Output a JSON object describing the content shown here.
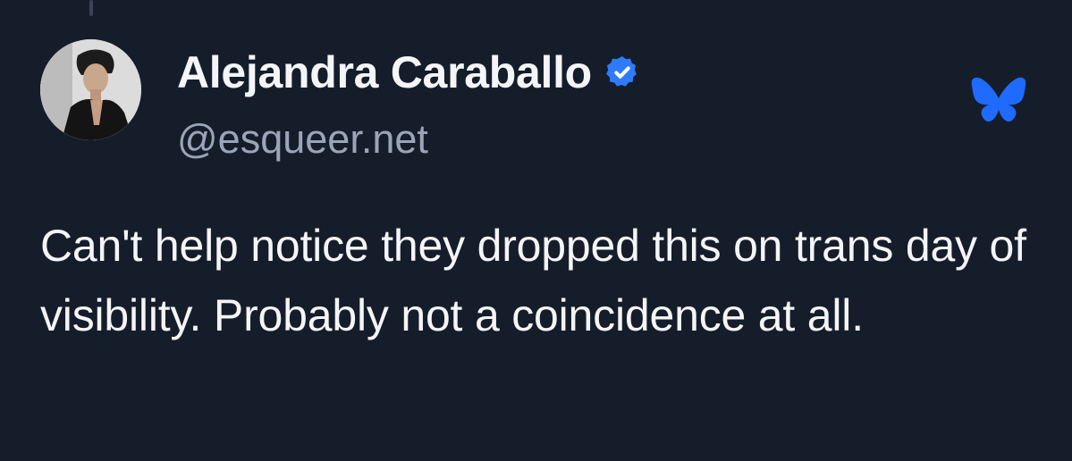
{
  "author": {
    "display_name": "Alejandra Caraballo",
    "handle": "@esqueer.net",
    "verified": true
  },
  "post": {
    "text": "Can't help notice they dropped this on trans day of visibility. Probably not a coincidence at all."
  },
  "icons": {
    "verified": "verified-check-icon",
    "platform": "bluesky-butterfly-icon"
  },
  "colors": {
    "background": "#161d2a",
    "text_primary": "#f3f5f8",
    "text_secondary": "#9aa6b8",
    "accent": "#1f6bff"
  }
}
